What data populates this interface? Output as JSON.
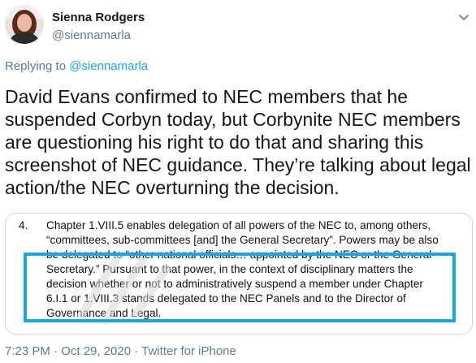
{
  "author": {
    "name": "Sienna Rodgers",
    "handle": "@siennamarla"
  },
  "reply": {
    "prefix": "Replying to",
    "to": "@siennamarla"
  },
  "tweet": {
    "text": "David Evans confirmed to NEC members that he suspended Corbyn today, but Corbynite NEC members are questioning his right to do that and sharing this screenshot of NEC guidance. They’re talking about legal action/the NEC overturning the decision."
  },
  "media": {
    "number": "4.",
    "lines": [
      "Chapter 1.VIII.5 enables delegation of all powers of the NEC to, among others,",
      "“committees, sub-committees [and] the General Secretary”.  Powers may be also",
      "be delegated to “other national officials… appointed by the NEC or the General",
      "Secretary.” Pursuant to that power, in the context of disciplinary matters the",
      "decision whether or not to administratively suspend a member under Chapter",
      "6.I.1 or 1.VIII.3 stands delegated to the NEC Panels and to the Director of",
      "Governance and Legal."
    ],
    "highlight_color": "#1aa7de"
  },
  "footer": {
    "time": "7:23 PM · Oct 29, 2020 · Twitter for iPhone"
  },
  "colors": {
    "link": "#1da1f2",
    "secondary": "#657786"
  }
}
